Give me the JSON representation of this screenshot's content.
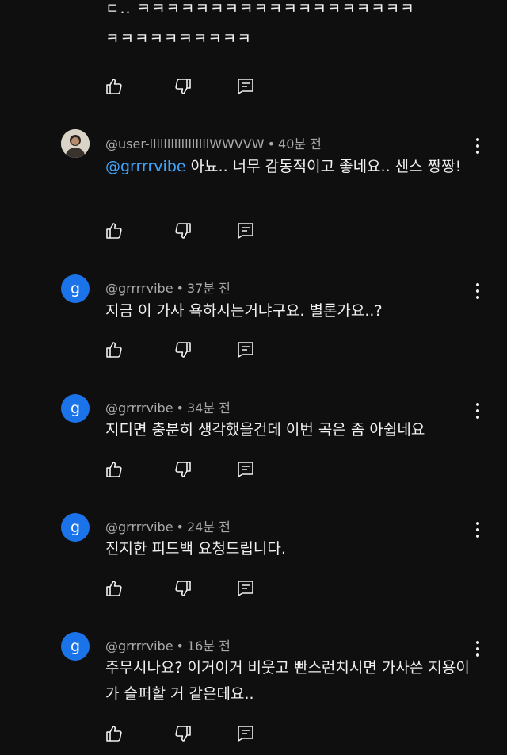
{
  "top_comment": {
    "text": "ㄷ.. ㅋㅋㅋㅋㅋㅋㅋㅋㅋㅋㅋㅋㅋㅋㅋㅋㅋㅋㅋ\nㅋㅋㅋㅋㅋㅋㅋㅋㅋㅋ"
  },
  "comments": [
    {
      "author": "@user-lllllllllllllllllWWVVW",
      "time": "40분 전",
      "mention": "@grrrrvibe",
      "text": "아뇨.. 너무 감동적이고 좋네요.. 센스 짱짱!",
      "avatar": "photo"
    },
    {
      "author": "@grrrrvibe",
      "time": "37분 전",
      "text": "지금 이 가사 욕하시는거냐구요. 별론가요..?",
      "avatar_letter": "g"
    },
    {
      "author": "@grrrrvibe",
      "time": "34분 전",
      "text": "지디면 충분히 생각했을건데 이번 곡은 좀 아쉽네요",
      "avatar_letter": "g"
    },
    {
      "author": "@grrrrvibe",
      "time": "24분 전",
      "text": "진지한 피드백 요청드립니다.",
      "avatar_letter": "g"
    },
    {
      "author": "@grrrrvibe",
      "time": "16분 전",
      "text": "주무시나요? 이거이거 비웃고 빤스런치시면 가사쓴 지용이가 슬퍼할 거 같은데요..",
      "avatar_letter": "g"
    }
  ],
  "separator": "•",
  "icons": {
    "like": "thumbs-up-icon",
    "dislike": "thumbs-down-icon",
    "reply": "reply-icon",
    "more": "more-vert-icon"
  },
  "colors": {
    "background": "#0f0f0f",
    "mention": "#3ea6ff",
    "avatar_letter_bg": "#1a73e8",
    "meta": "#aaaaaa"
  }
}
